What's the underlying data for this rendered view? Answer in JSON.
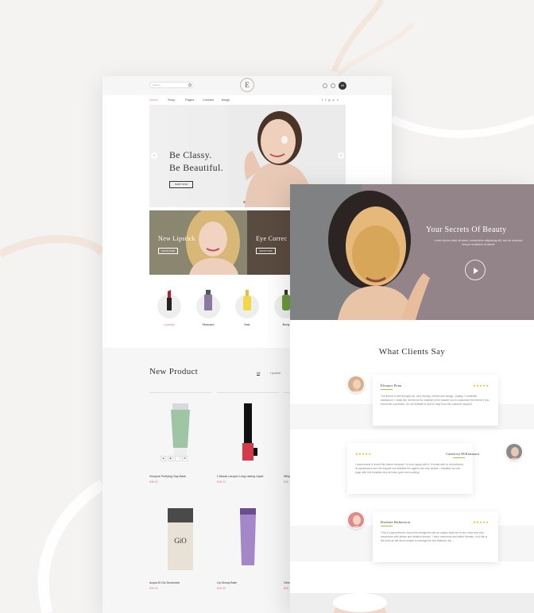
{
  "left_page": {
    "search_placeholder": "Search...",
    "logo_letter": "E",
    "cart_count": "00",
    "nav": [
      "Home",
      "Shop",
      "Pages",
      "Contact",
      "Blogs"
    ],
    "social": [
      "f",
      "t",
      "g",
      "p",
      "v"
    ],
    "hero": {
      "title_line1": "Be Classy.",
      "title_line2": "Be Beautiful.",
      "button": "SHOP NOW"
    },
    "promos": [
      {
        "title": "New Lipstick",
        "button": "SHOP NOW"
      },
      {
        "title": "Eye Correc",
        "button": "SHOP NOW"
      }
    ],
    "categories": [
      "Lipstick",
      "Skincare",
      "Hair",
      "Body"
    ],
    "new_product": {
      "title": "New Product",
      "tabs": [
        "All",
        "Lipstick"
      ],
      "products": [
        {
          "name": "Vinopure Purifying Clay Mask",
          "price": "$38.00"
        },
        {
          "name": "L'Absolu Lacquer Long Lasting Liquid",
          "price": "$38.00"
        },
        {
          "name": "Whip",
          "price": "$38"
        },
        {
          "name": "Acqua Di Gio Deodorant",
          "price": "$30.00"
        },
        {
          "name": "Lip Glossy Balm",
          "price": "$30.00"
        },
        {
          "name": "Gela",
          "price": "$38"
        }
      ]
    }
  },
  "right_page": {
    "video": {
      "title": "Your Secrets Of Beauty",
      "subtitle": "Lorem ipsum dolor sit amet, consectetur adipiscing elit, sed do eiusmod tempor incididunt ut labore"
    },
    "testimonials_title": "What Clients Say",
    "testimonials": [
      {
        "name": "Eleanor Pena",
        "stars": "★★★★★",
        "text": "The theme is well thought out, very friendly, refined and design. Quality + moderate assistance. I really like the theme for material in the answer you to customize the theme if you encounter a problem. do not hesitate to ask for help from the customer support."
      },
      {
        "name": "Cameron Williamson",
        "stars": "★★★★★",
        "text": "I recommend to insert this theme because I'm very happy with it. It works well on all platforms, its appearance and the support can stabilize the agents are very helpful. I installed my own page with this template and all looks good and working!"
      },
      {
        "name": "Darlene Robertson",
        "stars": "★★★★★",
        "text": "This is a great theme! Just a few designers with an unique style but it runs more and very responsive with allows and detailed service. I have numerous and better themes, a lot this is the tools as the demo simple to manage the key features, etc..."
      }
    ]
  },
  "colors": {
    "accent": "#d6868c",
    "star": "#f0b400",
    "dark": "#333333"
  }
}
